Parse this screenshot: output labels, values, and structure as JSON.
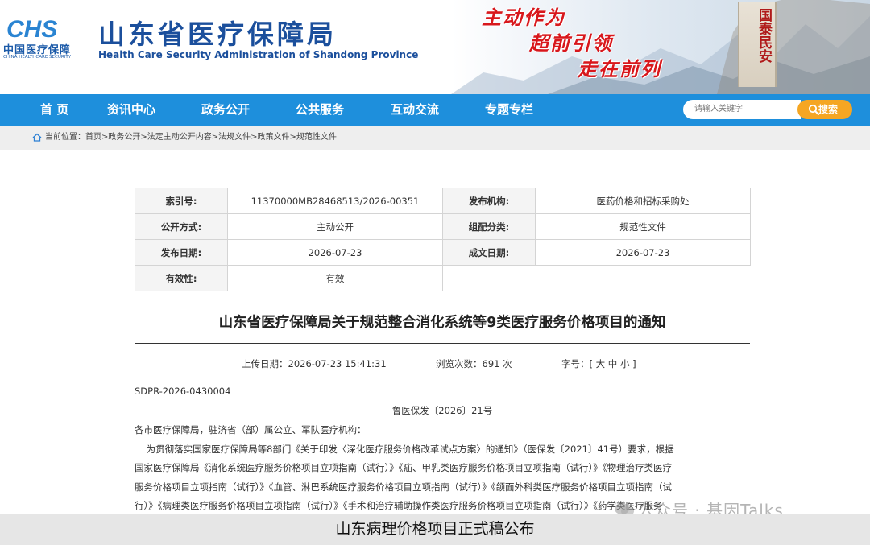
{
  "header": {
    "logo_mark": "CHS",
    "logo_cn": "中国医疗保障",
    "logo_en": "CHINA HEALTHCARE SECURITY",
    "title_cn": "山东省医疗保障局",
    "title_en": "Health Care Security Administration of Shandong Province",
    "slogans": [
      "主动作为",
      "超前引领",
      "走在前列"
    ],
    "stele_text": "国泰民安",
    "colors": {
      "brand_blue": "#1b4f9c",
      "slogan_red": "#d8171c"
    }
  },
  "nav": {
    "items": [
      {
        "label": "首  页"
      },
      {
        "label": "资讯中心"
      },
      {
        "label": "政务公开"
      },
      {
        "label": "公共服务"
      },
      {
        "label": "互动交流"
      },
      {
        "label": "专题专栏"
      }
    ],
    "search_placeholder": "请输入关键字",
    "search_button": "搜索",
    "colors": {
      "nav_bg": "#1e8fdc",
      "search_button": "#f5a623"
    }
  },
  "breadcrumb": {
    "prefix": "当前位置：",
    "path": "首页>政务公开>法定主动公开内容>法规文件>政策文件>规范性文件"
  },
  "meta": {
    "index_no_label": "索引号:",
    "index_no": "11370000MB28468513/2026-00351",
    "issuer_label": "发布机构:",
    "issuer": "医药价格和招标采购处",
    "open_mode_label": "公开方式:",
    "open_mode": "主动公开",
    "category_label": "组配分类:",
    "category": "规范性文件",
    "publish_date_label": "发布日期:",
    "publish_date": "2026-07-23",
    "written_date_label": "成文日期:",
    "written_date": "2026-07-23",
    "validity_label": "有效性:",
    "validity": "有效"
  },
  "article": {
    "title": "山东省医疗保障局关于规范整合消化系统等9类医疗服务价格项目的通知",
    "upload_time": "上传日期：2026-07-23 15:41:31",
    "views": "浏览次数：691 次",
    "font_size": "字号：[ 大 中 小 ]",
    "doc_code": "SDPR-2026-0430004",
    "file_no": "鲁医保发〔2026〕21号",
    "addressee": "各市医疗保障局，驻济省（部）属公立、军队医疗机构：",
    "lines": [
      "    为贯彻落实国家医疗保障局等8部门《关于印发〈深化医疗服务价格改革试点方案〉的通知》（医保发〔2021〕41号）要求，根据",
      "国家医疗保障局《消化系统医疗服务价格项目立项指南（试行）》《疝、甲乳类医疗服务价格项目立项指南（试行）》《物理治疗类医疗",
      "服务价格项目立项指南（试行）》《血管、淋巴系统医疗服务价格项目立项指南（试行）》《颌面外科类医疗服务价格项目立项指南（试",
      "行）》《病理类医疗服务价格项目立项指南（试行）》《手术和治疗辅助操作类医疗服务价格项目立项指南（试行）》《药学类医疗服务"
    ]
  },
  "watermark": "公众号 · 基因Talks",
  "caption": "山东病理价格项目正式稿公布"
}
